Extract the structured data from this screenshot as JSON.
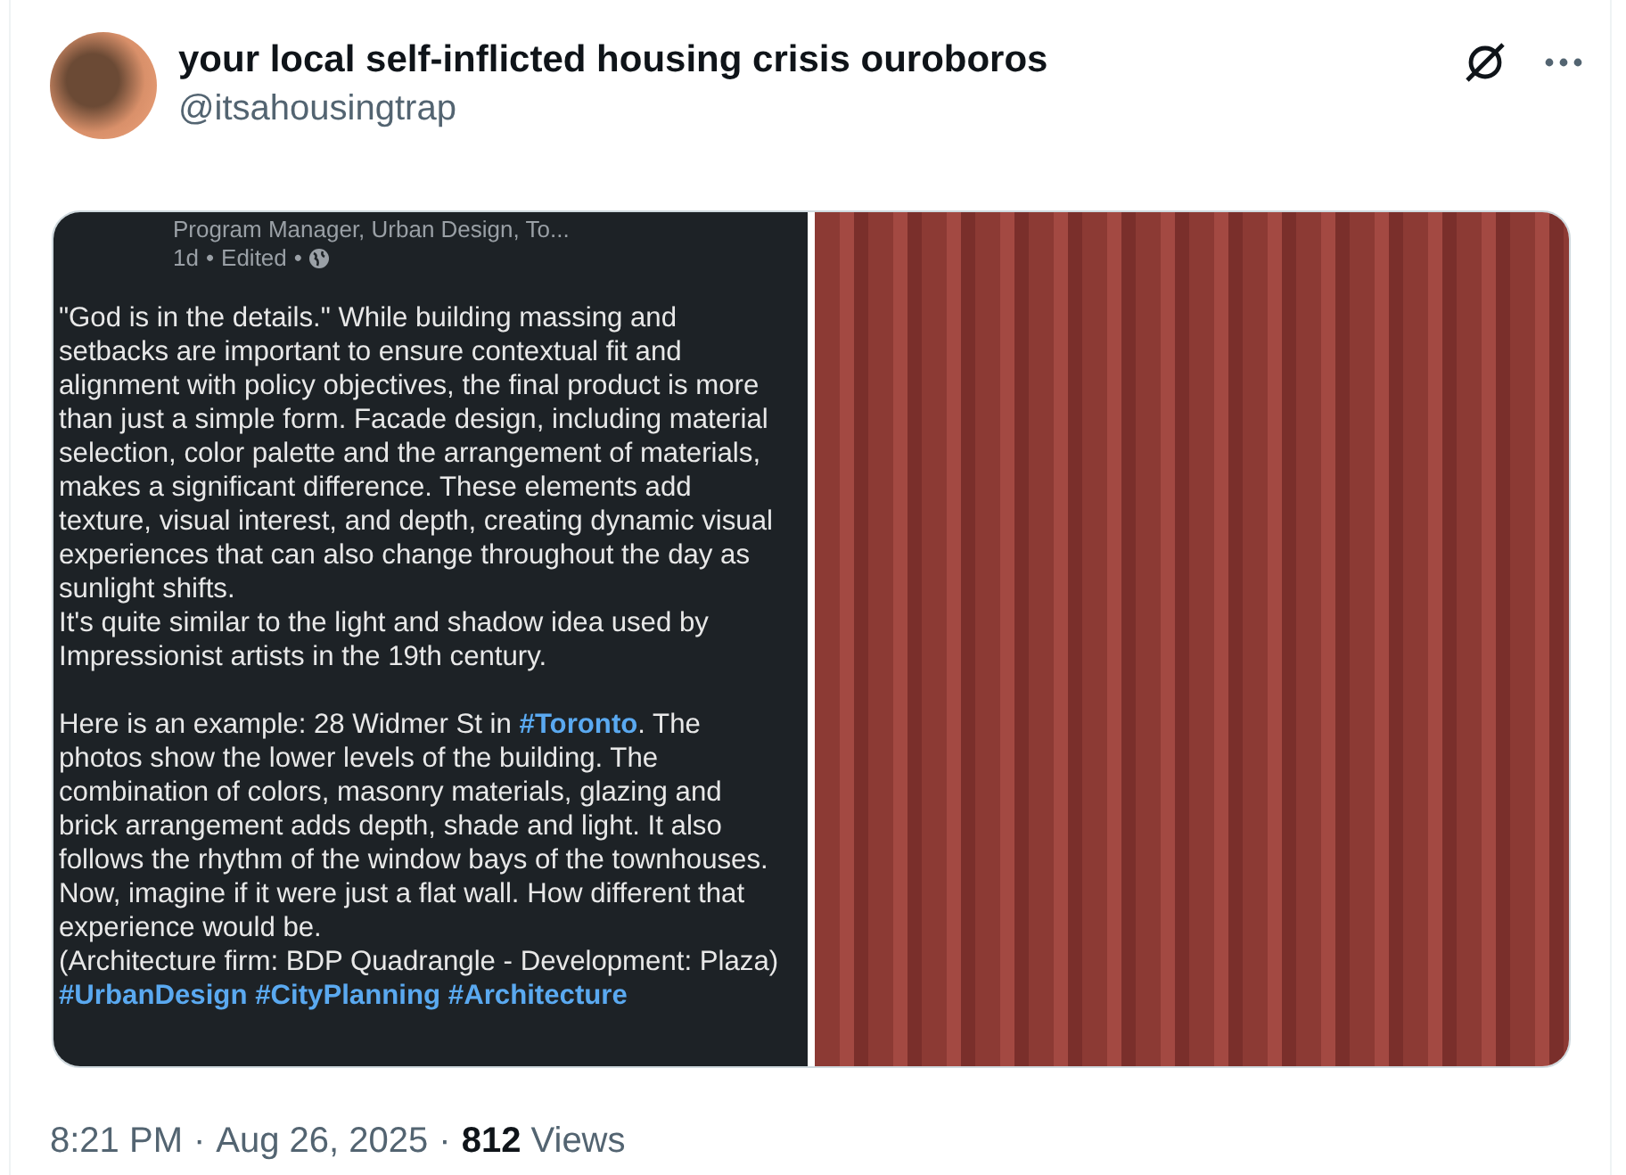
{
  "author": {
    "name": "your local self-inflicted housing crisis ouroboros",
    "handle": "@itsahousingtrap"
  },
  "screenshot": {
    "headline": "Program Manager, Urban Design, To...",
    "age": "1d",
    "edited": "Edited",
    "separator": "•",
    "blocks": [
      [
        {
          "segments": [
            {
              "kind": "plain",
              "text": "\"God is in the details.\" While building massing and setbacks are important to ensure contextual fit and alignment with policy objectives, the final product is more than just a simple form. Facade design, including material selection, color palette and the arrangement of materials, makes a significant difference. These elements add texture, visual interest, and depth, creating dynamic visual experiences that can also change throughout the day as sunlight shifts."
            }
          ]
        },
        {
          "segments": [
            {
              "kind": "plain",
              "text": "It's quite similar to the light and shadow idea used by Impressionist artists in the 19th century."
            }
          ]
        }
      ],
      [
        {
          "segments": [
            {
              "kind": "plain",
              "text": "Here is an example: 28 Widmer St in "
            },
            {
              "kind": "hashtag",
              "text": "#Toronto"
            },
            {
              "kind": "plain",
              "text": ". The photos show the lower levels of the building. The combination of colors, masonry materials, glazing and brick arrangement adds depth, shade and light. It also follows the rhythm of the window bays of the townhouses. Now, imagine if it were just a flat wall. How different that experience would be."
            }
          ]
        },
        {
          "segments": [
            {
              "kind": "plain",
              "text": "(Architecture firm: BDP Quadrangle - Development: Plaza)"
            }
          ]
        },
        {
          "segments": [
            {
              "kind": "hashtag",
              "text": "#UrbanDesign"
            },
            {
              "kind": "hashtag",
              "text": "#CityPlanning"
            },
            {
              "kind": "hashtag",
              "text": "#Architecture"
            }
          ]
        }
      ]
    ]
  },
  "footer": {
    "time": "8:21 PM",
    "separator": "·",
    "date": "Aug 26, 2025",
    "views_count": "812",
    "views_label": "Views"
  }
}
